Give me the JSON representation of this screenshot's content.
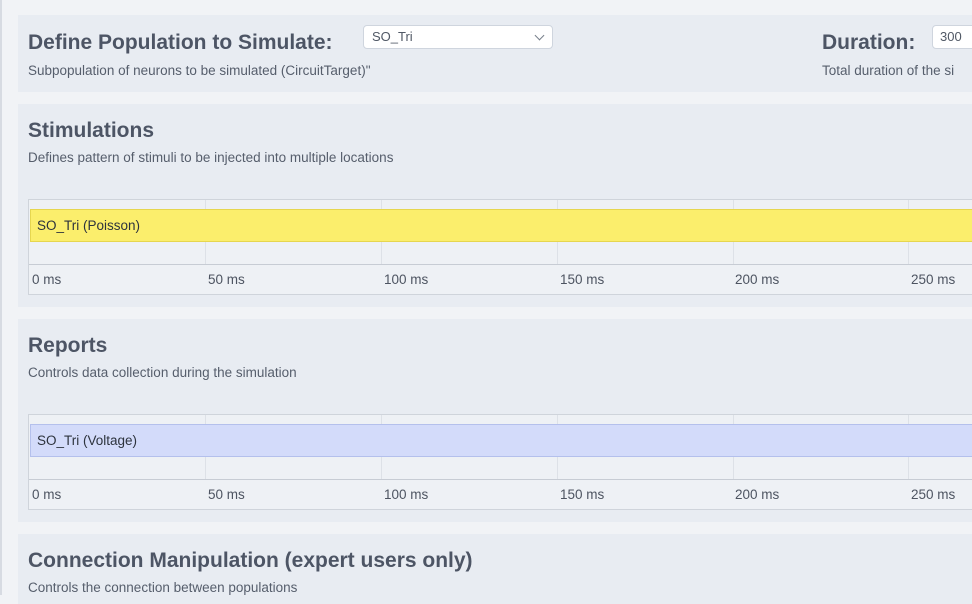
{
  "population": {
    "title": "Define Population to Simulate:",
    "selected": "SO_Tri",
    "description": "Subpopulation of neurons to be simulated (CircuitTarget)\""
  },
  "duration": {
    "title": "Duration:",
    "value": "300",
    "description": "Total duration of the si"
  },
  "stimulations": {
    "title": "Stimulations",
    "description": "Defines pattern of stimuli to be injected into multiple locations",
    "bar_label": "SO_Tri (Poisson)",
    "bar_color": "#fbee6c",
    "ticks": [
      "0 ms",
      "50 ms",
      "100 ms",
      "150 ms",
      "200 ms",
      "250 ms"
    ]
  },
  "reports": {
    "title": "Reports",
    "description": "Controls data collection during the simulation",
    "bar_label": "SO_Tri (Voltage)",
    "bar_color": "#d3dbfa",
    "ticks": [
      "0 ms",
      "50 ms",
      "100 ms",
      "150 ms",
      "200 ms",
      "250 ms"
    ]
  },
  "connection": {
    "title": "Connection Manipulation (expert users only)",
    "description": "Controls the connection between populations"
  }
}
